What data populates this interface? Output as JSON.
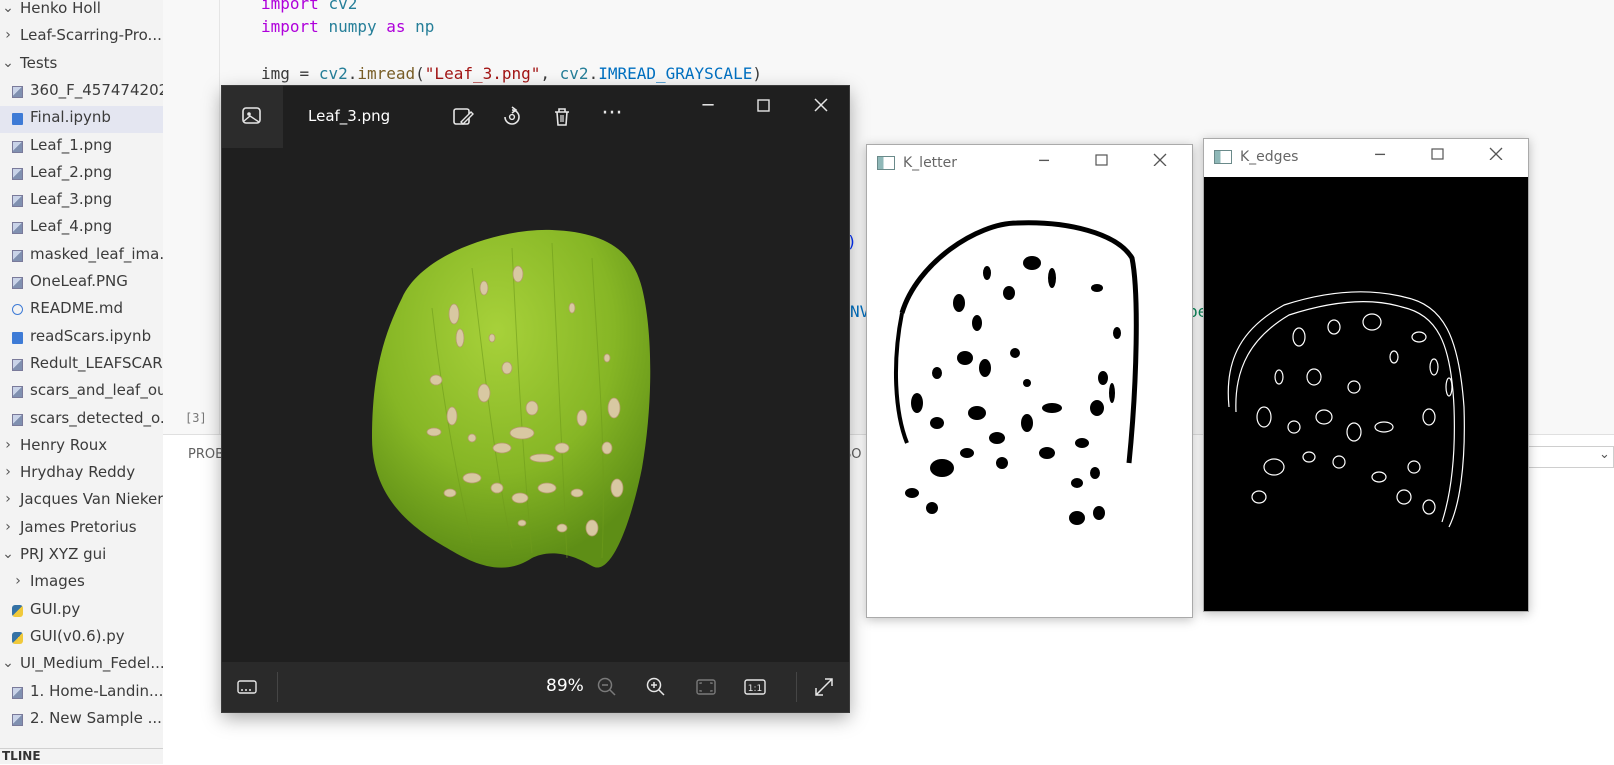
{
  "explorer": {
    "items": [
      {
        "label": "Henko Holl",
        "chevron": "⌄",
        "icon": ""
      },
      {
        "label": "Leaf-Scarring-Pro...",
        "chevron": "›",
        "icon": ""
      },
      {
        "label": "Tests",
        "chevron": "⌄",
        "icon": ""
      },
      {
        "label": "360_F_457474202...",
        "chevron": "",
        "icon": "image-file-icon"
      },
      {
        "label": "Final.ipynb",
        "chevron": "",
        "icon": "notebook-file-icon"
      },
      {
        "label": "Leaf_1.png",
        "chevron": "",
        "icon": "image-file-icon"
      },
      {
        "label": "Leaf_2.png",
        "chevron": "",
        "icon": "image-file-icon"
      },
      {
        "label": "Leaf_3.png",
        "chevron": "",
        "icon": "image-file-icon"
      },
      {
        "label": "Leaf_4.png",
        "chevron": "",
        "icon": "image-file-icon"
      },
      {
        "label": "masked_leaf_ima...",
        "chevron": "",
        "icon": "image-file-icon"
      },
      {
        "label": "OneLeaf.PNG",
        "chevron": "",
        "icon": "image-file-icon"
      },
      {
        "label": "README.md",
        "chevron": "",
        "icon": "info-file-icon"
      },
      {
        "label": "readScars.ipynb",
        "chevron": "",
        "icon": "notebook-file-icon"
      },
      {
        "label": "Redult_LEAFSCAR...",
        "chevron": "",
        "icon": "image-file-icon"
      },
      {
        "label": "scars_and_leaf_ou...",
        "chevron": "",
        "icon": "image-file-icon"
      },
      {
        "label": "scars_detected_o...",
        "chevron": "",
        "icon": "image-file-icon"
      },
      {
        "label": "Henry Roux",
        "chevron": "›",
        "icon": ""
      },
      {
        "label": "Hrydhay Reddy",
        "chevron": "›",
        "icon": ""
      },
      {
        "label": "Jacques Van Niekerk",
        "chevron": "›",
        "icon": ""
      },
      {
        "label": "James Pretorius",
        "chevron": "›",
        "icon": ""
      },
      {
        "label": "PRJ XYZ gui",
        "chevron": "⌄",
        "icon": ""
      },
      {
        "label": "Images",
        "chevron": "›",
        "icon": ""
      },
      {
        "label": "GUI.py",
        "chevron": "",
        "icon": "python-file-icon"
      },
      {
        "label": "GUI(v0.6).py",
        "chevron": "",
        "icon": "python-file-icon"
      },
      {
        "label": "UI_Medium_Fedel...",
        "chevron": "⌄",
        "icon": ""
      },
      {
        "label": "1. Home-Landin...",
        "chevron": "",
        "icon": "image-file-icon"
      },
      {
        "label": "2. New Sample ...",
        "chevron": "",
        "icon": "image-file-icon"
      }
    ],
    "outline_label": "TLINE"
  },
  "editor": {
    "line1": {
      "kw": "import",
      "mod": "cv2"
    },
    "line2": {
      "kw": "import",
      "mod": "numpy",
      "as": "as",
      "alias": "np"
    },
    "line4": {
      "var": "img",
      "eq": " = ",
      "mod": "cv2",
      "dot": ".",
      "fn": "imread",
      "open": "(",
      "str": "\"Leaf_3.png\"",
      "comma": ", ",
      "mod2": "cv2",
      "dot2": ".",
      "cst": "IMREAD_GRAYSCALE",
      "close": ")"
    },
    "frag_paren": ")",
    "frag_nv": "NV",
    "frag_be": "be",
    "exec_count": "[3]"
  },
  "panel": {
    "tab_problems": "PROB",
    "tab_frag": "SO"
  },
  "photo_viewer": {
    "title": "Leaf_3.png",
    "zoom": "89%",
    "icons": [
      "photos-app-icon",
      "edit-image-icon",
      "rotate-icon",
      "delete-icon",
      "more-icon",
      "filmstrip-icon",
      "zoom-out-icon",
      "zoom-in-icon",
      "fit-icon",
      "actual-size-icon",
      "fullscreen-icon"
    ],
    "actual_size_label": "1:1"
  },
  "cv_windows": [
    {
      "title": "K_letter",
      "background": "#ffffff"
    },
    {
      "title": "K_edges",
      "background": "#000000"
    }
  ],
  "colors": {
    "leaf_green": "#8fbf2a",
    "leaf_dark": "#5f8f1c",
    "scar": "#d6c6a4",
    "viewer_bg": "#1f1f1f"
  }
}
